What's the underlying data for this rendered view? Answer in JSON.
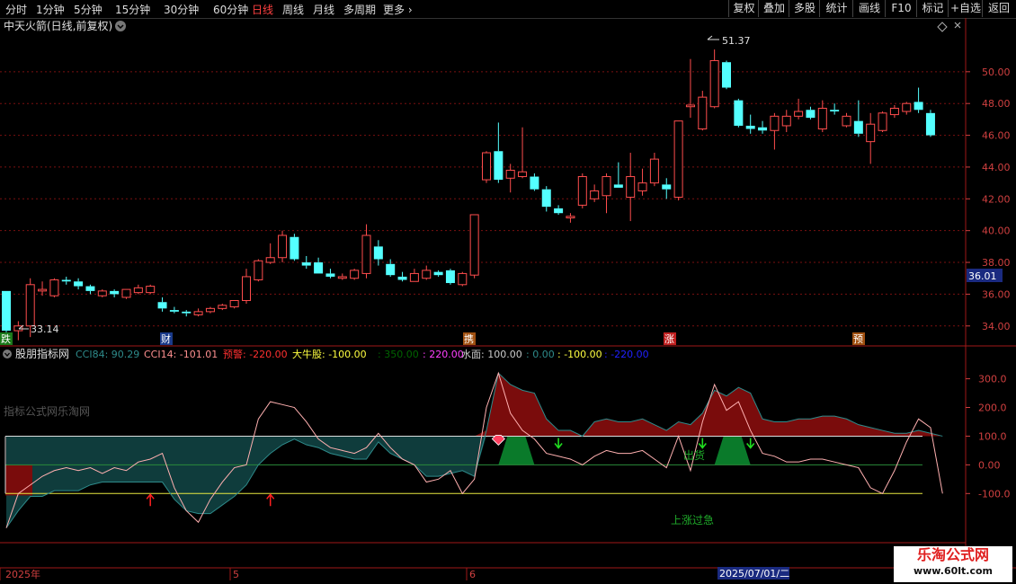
{
  "toolbar": {
    "periods": [
      "分时",
      "1分钟",
      "5分钟",
      "15分钟",
      "30分钟",
      "60分钟",
      "日线",
      "周线",
      "月线",
      "多周期",
      "更多"
    ],
    "active_period": "日线",
    "right_buttons": [
      "复权",
      "叠加",
      "多股",
      "统计",
      "画线",
      "F10",
      "标记",
      "+自选",
      "返回"
    ]
  },
  "main_chart": {
    "title": "中天火箭(日线,前复权)",
    "high_label": "51.37",
    "low_label": "33.14",
    "current_price_tag": "36.01",
    "event_markers": [
      "跌",
      "财",
      "携",
      "涨",
      "预"
    ],
    "colors": {
      "up": "#ff4d4d",
      "down": "#54ffff",
      "grid": "#7a1010",
      "axis": "#d04040"
    },
    "chart_data": {
      "type": "candlestick",
      "y_ticks": [
        "50.00",
        "48.00",
        "46.00",
        "44.00",
        "42.00",
        "40.00",
        "38.00",
        "36.00",
        "34.00"
      ],
      "ylim": [
        32.8,
        51.8
      ],
      "candles": [
        {
          "o": 36.2,
          "h": 36.2,
          "l": 33.6,
          "c": 33.7
        },
        {
          "o": 33.7,
          "h": 34.3,
          "l": 33.1,
          "c": 34.0
        },
        {
          "o": 34.0,
          "h": 37.0,
          "l": 33.3,
          "c": 36.6
        },
        {
          "o": 36.2,
          "h": 36.8,
          "l": 35.9,
          "c": 36.3
        },
        {
          "o": 35.9,
          "h": 37.0,
          "l": 35.8,
          "c": 36.9
        },
        {
          "o": 36.9,
          "h": 37.1,
          "l": 36.6,
          "c": 36.8
        },
        {
          "o": 36.8,
          "h": 37.0,
          "l": 36.3,
          "c": 36.5
        },
        {
          "o": 36.5,
          "h": 36.6,
          "l": 36.0,
          "c": 36.2
        },
        {
          "o": 35.9,
          "h": 36.3,
          "l": 35.8,
          "c": 36.2
        },
        {
          "o": 36.2,
          "h": 36.3,
          "l": 35.8,
          "c": 36.0
        },
        {
          "o": 35.8,
          "h": 36.3,
          "l": 35.7,
          "c": 36.3
        },
        {
          "o": 36.1,
          "h": 36.6,
          "l": 36.0,
          "c": 36.4
        },
        {
          "o": 36.1,
          "h": 36.6,
          "l": 36.0,
          "c": 36.5
        },
        {
          "o": 35.5,
          "h": 35.8,
          "l": 34.9,
          "c": 35.1
        },
        {
          "o": 35.0,
          "h": 35.2,
          "l": 34.8,
          "c": 34.9
        },
        {
          "o": 34.9,
          "h": 35.0,
          "l": 34.6,
          "c": 34.8
        },
        {
          "o": 34.7,
          "h": 35.1,
          "l": 34.6,
          "c": 34.9
        },
        {
          "o": 34.9,
          "h": 35.2,
          "l": 34.8,
          "c": 35.1
        },
        {
          "o": 35.1,
          "h": 35.4,
          "l": 35.0,
          "c": 35.3
        },
        {
          "o": 35.2,
          "h": 35.6,
          "l": 35.1,
          "c": 35.6
        },
        {
          "o": 35.6,
          "h": 37.6,
          "l": 35.4,
          "c": 37.1
        },
        {
          "o": 36.9,
          "h": 38.2,
          "l": 36.8,
          "c": 38.1
        },
        {
          "o": 38.0,
          "h": 39.2,
          "l": 37.9,
          "c": 38.3
        },
        {
          "o": 38.3,
          "h": 40.0,
          "l": 38.0,
          "c": 39.7
        },
        {
          "o": 39.6,
          "h": 39.8,
          "l": 38.1,
          "c": 38.2
        },
        {
          "o": 38.0,
          "h": 38.4,
          "l": 37.6,
          "c": 37.8
        },
        {
          "o": 38.0,
          "h": 38.3,
          "l": 37.3,
          "c": 37.3
        },
        {
          "o": 37.3,
          "h": 37.6,
          "l": 37.0,
          "c": 37.1
        },
        {
          "o": 37.0,
          "h": 37.3,
          "l": 36.9,
          "c": 37.1
        },
        {
          "o": 37.0,
          "h": 37.6,
          "l": 36.9,
          "c": 37.5
        },
        {
          "o": 37.3,
          "h": 40.4,
          "l": 37.0,
          "c": 39.7
        },
        {
          "o": 39.0,
          "h": 39.4,
          "l": 37.8,
          "c": 38.2
        },
        {
          "o": 37.9,
          "h": 38.2,
          "l": 37.1,
          "c": 37.2
        },
        {
          "o": 37.1,
          "h": 37.4,
          "l": 36.8,
          "c": 36.9
        },
        {
          "o": 36.8,
          "h": 37.6,
          "l": 36.8,
          "c": 37.3
        },
        {
          "o": 37.0,
          "h": 37.8,
          "l": 36.9,
          "c": 37.5
        },
        {
          "o": 37.4,
          "h": 37.5,
          "l": 37.1,
          "c": 37.2
        },
        {
          "o": 37.5,
          "h": 37.6,
          "l": 36.6,
          "c": 36.7
        },
        {
          "o": 36.6,
          "h": 37.4,
          "l": 36.5,
          "c": 37.3
        },
        {
          "o": 37.2,
          "h": 41.0,
          "l": 37.0,
          "c": 41.0
        },
        {
          "o": 43.2,
          "h": 45.0,
          "l": 43.0,
          "c": 44.9
        },
        {
          "o": 45.0,
          "h": 46.8,
          "l": 43.0,
          "c": 43.2
        },
        {
          "o": 43.3,
          "h": 44.2,
          "l": 42.4,
          "c": 43.8
        },
        {
          "o": 43.4,
          "h": 46.5,
          "l": 43.3,
          "c": 43.7
        },
        {
          "o": 43.4,
          "h": 43.6,
          "l": 42.5,
          "c": 42.6
        },
        {
          "o": 42.6,
          "h": 42.8,
          "l": 41.2,
          "c": 41.5
        },
        {
          "o": 41.4,
          "h": 41.6,
          "l": 41.0,
          "c": 41.1
        },
        {
          "o": 40.8,
          "h": 41.1,
          "l": 40.5,
          "c": 40.9
        },
        {
          "o": 41.6,
          "h": 43.6,
          "l": 41.4,
          "c": 43.4
        },
        {
          "o": 42.0,
          "h": 42.9,
          "l": 41.8,
          "c": 42.5
        },
        {
          "o": 42.2,
          "h": 43.6,
          "l": 41.1,
          "c": 43.4
        },
        {
          "o": 42.9,
          "h": 44.3,
          "l": 42.7,
          "c": 42.7
        },
        {
          "o": 42.1,
          "h": 44.9,
          "l": 40.6,
          "c": 43.4
        },
        {
          "o": 42.5,
          "h": 43.9,
          "l": 42.2,
          "c": 43.0
        },
        {
          "o": 43.0,
          "h": 44.9,
          "l": 42.8,
          "c": 44.5
        },
        {
          "o": 42.9,
          "h": 43.3,
          "l": 42.0,
          "c": 42.6
        },
        {
          "o": 42.1,
          "h": 46.9,
          "l": 41.9,
          "c": 46.9
        },
        {
          "o": 47.8,
          "h": 50.8,
          "l": 47.1,
          "c": 47.9
        },
        {
          "o": 46.4,
          "h": 48.8,
          "l": 46.3,
          "c": 48.4
        },
        {
          "o": 47.8,
          "h": 51.4,
          "l": 47.7,
          "c": 50.7
        },
        {
          "o": 50.6,
          "h": 50.7,
          "l": 48.9,
          "c": 49.0
        },
        {
          "o": 48.2,
          "h": 48.3,
          "l": 46.5,
          "c": 46.6
        },
        {
          "o": 46.6,
          "h": 47.3,
          "l": 46.1,
          "c": 46.4
        },
        {
          "o": 46.5,
          "h": 46.9,
          "l": 46.1,
          "c": 46.3
        },
        {
          "o": 46.3,
          "h": 47.4,
          "l": 45.1,
          "c": 47.2
        },
        {
          "o": 46.6,
          "h": 47.6,
          "l": 46.2,
          "c": 47.2
        },
        {
          "o": 47.2,
          "h": 48.3,
          "l": 47.0,
          "c": 47.5
        },
        {
          "o": 47.6,
          "h": 47.8,
          "l": 47.0,
          "c": 47.1
        },
        {
          "o": 46.4,
          "h": 48.2,
          "l": 46.2,
          "c": 47.7
        },
        {
          "o": 47.6,
          "h": 48.0,
          "l": 47.3,
          "c": 47.5
        },
        {
          "o": 46.6,
          "h": 47.4,
          "l": 46.5,
          "c": 47.2
        },
        {
          "o": 46.9,
          "h": 48.2,
          "l": 45.9,
          "c": 46.1
        },
        {
          "o": 45.6,
          "h": 47.4,
          "l": 44.2,
          "c": 46.7
        },
        {
          "o": 46.3,
          "h": 47.5,
          "l": 46.2,
          "c": 47.4
        },
        {
          "o": 47.3,
          "h": 47.9,
          "l": 47.1,
          "c": 47.7
        },
        {
          "o": 47.5,
          "h": 48.1,
          "l": 47.3,
          "c": 48.0
        },
        {
          "o": 48.1,
          "h": 49.0,
          "l": 47.4,
          "c": 47.6
        },
        {
          "o": 47.4,
          "h": 47.6,
          "l": 45.9,
          "c": 46.0
        }
      ]
    }
  },
  "indicator": {
    "name": "股朋指标网",
    "values": [
      {
        "label": "CCI84: 90.29",
        "color": "#2e8b8b"
      },
      {
        "label": "CCI14: -101.01",
        "color": "#ff9090"
      },
      {
        "label": "预警: -220.00",
        "color": "#ff3030"
      },
      {
        "label": "大牛股: -100.00",
        "color": "#ffff40"
      },
      {
        "label": ": 350.00",
        "color": "#006400"
      },
      {
        "label": ": 220.00",
        "color": "#ff40ff"
      },
      {
        "label": "水面: 100.00",
        "color": "#cccccc"
      },
      {
        "label": ": 0.00",
        "color": "#2e8b8b"
      },
      {
        "label": ": -100.00",
        "color": "#ffff40"
      },
      {
        "label": ": -220.00",
        "color": "#2020ff"
      }
    ],
    "watermark_text": "指标公式网乐淘网",
    "annotations": {
      "sell": "出货",
      "overheat": "上涨过急"
    },
    "chart_data": {
      "type": "line",
      "y_ticks": [
        "300.0",
        "200.0",
        "100.0",
        "0.00",
        "-100.0"
      ],
      "ylim": [
        -265,
        330
      ],
      "cci14": [
        -220,
        -100,
        -70,
        -40,
        -20,
        -10,
        -20,
        -10,
        -30,
        -10,
        -20,
        10,
        20,
        40,
        -80,
        -160,
        -200,
        -120,
        -60,
        -10,
        0,
        160,
        220,
        210,
        200,
        150,
        90,
        60,
        50,
        40,
        60,
        110,
        60,
        20,
        0,
        -60,
        -50,
        -20,
        -100,
        -50,
        200,
        320,
        180,
        120,
        90,
        40,
        30,
        20,
        0,
        30,
        50,
        40,
        40,
        50,
        20,
        -10,
        100,
        -20,
        150,
        280,
        190,
        220,
        120,
        40,
        30,
        10,
        10,
        20,
        20,
        10,
        0,
        -10,
        -80,
        -100,
        -20,
        80,
        160,
        130,
        -100
      ],
      "cci84": [
        -220,
        -160,
        -110,
        -110,
        -90,
        -90,
        -90,
        -70,
        -60,
        -60,
        -60,
        -60,
        -60,
        -60,
        -120,
        -160,
        -170,
        -170,
        -140,
        -110,
        -70,
        0,
        40,
        70,
        90,
        70,
        60,
        40,
        30,
        20,
        20,
        80,
        40,
        20,
        0,
        -40,
        -40,
        -30,
        -20,
        -40,
        120,
        320,
        280,
        260,
        250,
        160,
        120,
        120,
        100,
        150,
        160,
        150,
        150,
        160,
        140,
        120,
        150,
        140,
        180,
        260,
        240,
        270,
        250,
        160,
        150,
        150,
        160,
        160,
        170,
        170,
        160,
        140,
        130,
        120,
        110,
        110,
        120,
        110,
        100
      ],
      "sell_zones": [
        [
          41,
          44
        ],
        [
          59,
          62
        ]
      ],
      "up_arrows": [
        12,
        22
      ],
      "down_arrows": [
        46,
        58,
        62
      ],
      "diamond_index": 41
    }
  },
  "time_axis": {
    "labels": [
      "2025年",
      "5",
      "6"
    ],
    "cursor_label": "2025/07/01/二"
  },
  "watermark": {
    "title": "乐淘公式网",
    "url": "www.60lt.com"
  }
}
